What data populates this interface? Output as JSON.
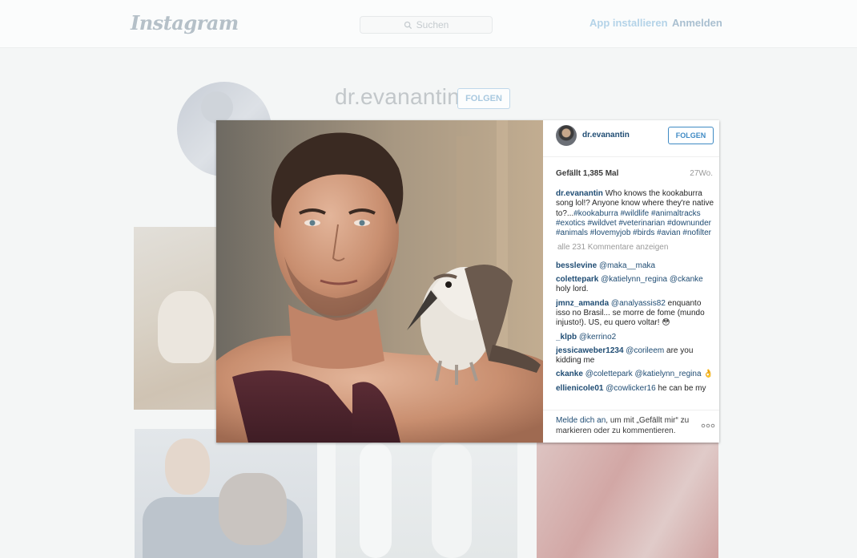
{
  "header": {
    "logo": "Instagram",
    "search_placeholder": "Suchen",
    "install_app": "App installieren",
    "login": "Anmelden"
  },
  "profile": {
    "username": "dr.evanantin",
    "follow_label": "FOLGEN"
  },
  "modal": {
    "username": "dr.evanantin",
    "follow_label": "FOLGEN",
    "likes": "Gefällt 1,385 Mal",
    "age": "27Wo.",
    "caption": {
      "user": "dr.evanantin",
      "text": "Who knows the kookaburra song lol!? Anyone know where they're native to?...",
      "hashtags": "#kookaburra #wildlife #animaltracks #exotics #wildvet #veterinarian #downunder #animals #lovemyjob #birds #avian #nofilter"
    },
    "all_comments": "alle 231 Kommentare anzeigen",
    "comments": [
      {
        "user": "besslevine",
        "mention": "@maka__maka",
        "text": ""
      },
      {
        "user": "colettepark",
        "mention": "@katielynn_regina @ckanke",
        "text": "holy lord."
      },
      {
        "user": "jmnz_amanda",
        "mention": "@analyassis82",
        "text": "enquanto isso no Brasil... se morre de fome (mundo injusto!). US, eu quero voltar! 😳"
      },
      {
        "user": "_klpb",
        "mention": "@kerrino2",
        "text": ""
      },
      {
        "user": "jessicaweber1234",
        "mention": "@corileem",
        "text": "are you kidding me"
      },
      {
        "user": "ckanke",
        "mention": "@colettepark @katielynn_regina",
        "text": "👌"
      },
      {
        "user": "ellienicole01",
        "mention": "@cowlicker16",
        "text": "he can be my"
      }
    ],
    "footer": {
      "login_link": "Melde dich an",
      "text": ", um mit „Gefällt mir“ zu markieren oder zu kommentieren."
    }
  }
}
